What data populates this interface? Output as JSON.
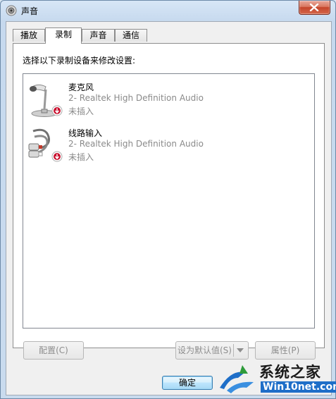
{
  "window": {
    "title": "声音",
    "title_icon": "speaker-icon",
    "close_icon": "close-icon"
  },
  "tabs": [
    {
      "label": "播放",
      "active": false
    },
    {
      "label": "录制",
      "active": true
    },
    {
      "label": "声音",
      "active": false
    },
    {
      "label": "通信",
      "active": false
    }
  ],
  "panel": {
    "instruction": "选择以下录制设备来修改设置:"
  },
  "devices": [
    {
      "name": "麦克风",
      "description": "2- Realtek High Definition Audio",
      "status": "未插入",
      "icon": "microphone-icon",
      "badge_icon": "unplugged-icon"
    },
    {
      "name": "线路输入",
      "description": "2- Realtek High Definition Audio",
      "status": "未插入",
      "icon": "line-in-icon",
      "badge_icon": "unplugged-icon"
    }
  ],
  "buttons": {
    "configure": "配置(C)",
    "set_default": "设为默认值(S)",
    "properties": "属性(P)",
    "ok": "确定"
  },
  "watermark": {
    "title": "系统之家",
    "subtitle": "Win10net.com"
  },
  "colors": {
    "accent": "#3c7fb1",
    "disabled_text": "#8d8d8d",
    "status_badge": "#c8102e"
  }
}
